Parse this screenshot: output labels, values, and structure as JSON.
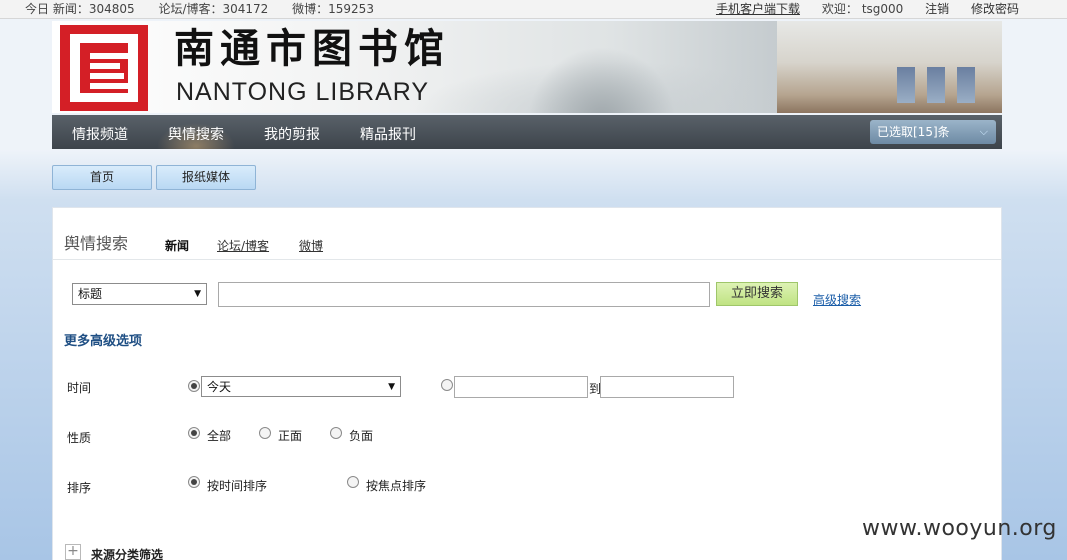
{
  "topbar": {
    "today_news": "今日 新闻：304805",
    "forum_blog": "论坛/博客：304172",
    "weibo": "微博：159253",
    "mobile_download": "手机客户端下载",
    "welcome": "欢迎：",
    "username": "tsg000",
    "logout": "注销",
    "change_password": "修改密码"
  },
  "banner": {
    "name_cn": "南通市图书馆",
    "name_en": "NANTONG LIBRARY",
    "logo_color": "#d41f26"
  },
  "nav": {
    "items": [
      {
        "label": "情报频道"
      },
      {
        "label": "舆情搜索"
      },
      {
        "label": "我的剪报"
      },
      {
        "label": "精品报刊"
      }
    ],
    "selected_label": "已选取[15]条",
    "chevron": "chevron-down-icon"
  },
  "buttons": {
    "home": "首页",
    "newspaper_media": "报纸媒体"
  },
  "search": {
    "title": "舆情搜索",
    "tabs": [
      "新闻",
      "论坛/博客",
      "微博"
    ],
    "field_select": "标题",
    "keyword_value": "",
    "search_button": "立即搜索",
    "advanced_link": "高级搜索",
    "more_options": "更多高级选项",
    "time_label": "时间",
    "time_select": "今天",
    "date_to": "到",
    "date_from_value": "",
    "date_to_value": "",
    "nature_label": "性质",
    "nature_options": [
      "全部",
      "正面",
      "负面"
    ],
    "sort_label": "排序",
    "sort_options": [
      "按时间排序",
      "按焦点排序"
    ],
    "source_filter": "来源分类筛选"
  },
  "watermark": "www.wooyun.org"
}
